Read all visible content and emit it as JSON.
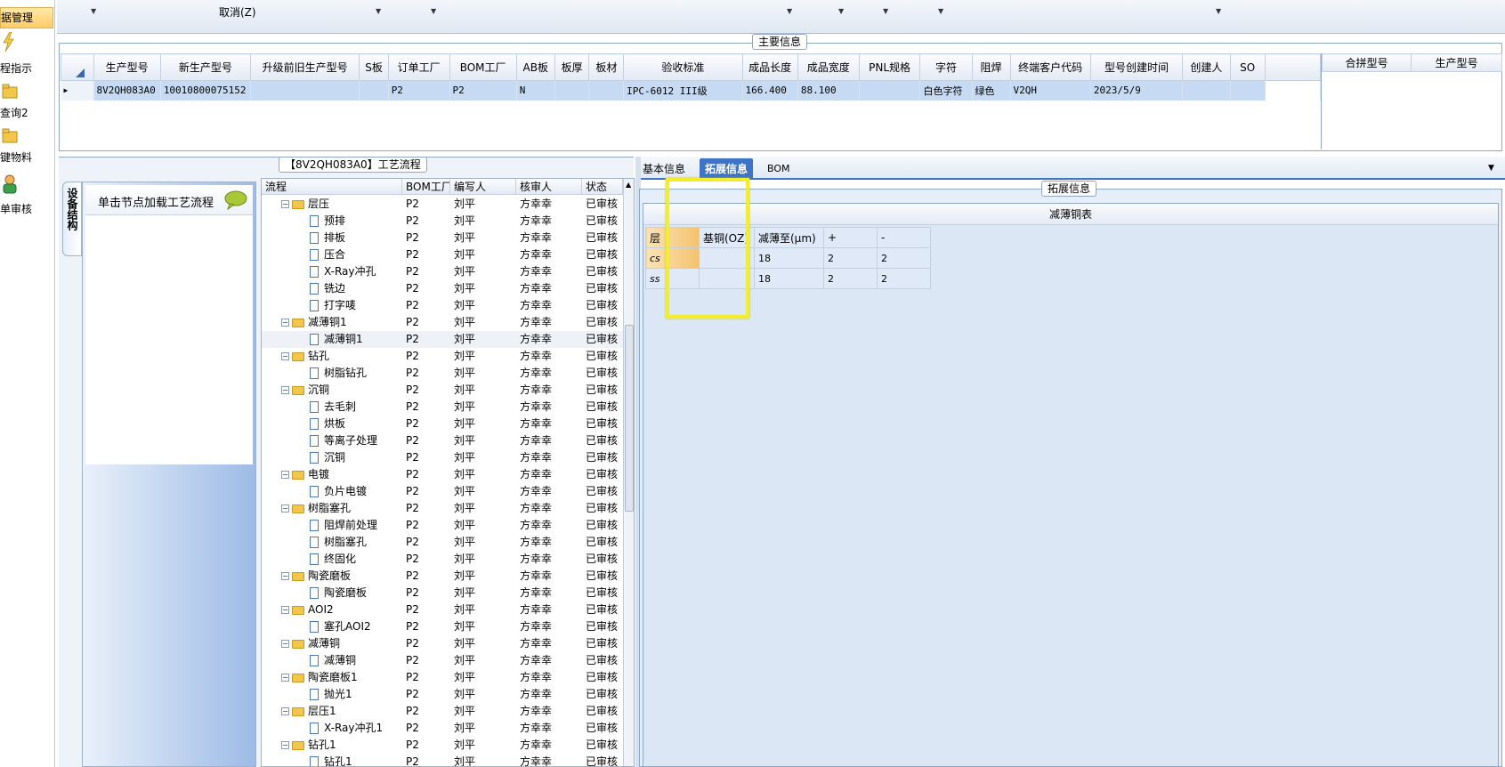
{
  "nav": {
    "items": [
      {
        "label": "据管理",
        "icon": "folder-icon"
      },
      {
        "label": "程指示",
        "icon": "lightning-icon"
      },
      {
        "label": "查询2",
        "icon": "folder-icon"
      },
      {
        "label": "键物料",
        "icon": "folder-icon"
      },
      {
        "label": "单审核",
        "icon": "user-icon"
      }
    ]
  },
  "toolbar": {
    "cancel_label": "取消(Z)"
  },
  "main_info": {
    "title": "主要信息",
    "columns": [
      "生产型号",
      "新生产型号",
      "升级前旧生产型号",
      "S板",
      "订单工厂",
      "BOM工厂",
      "AB板",
      "板厚",
      "板材",
      "验收标准",
      "成品长度",
      "成品宽度",
      "PNL规格",
      "字符",
      "阻焊",
      "终端客户代码",
      "型号创建时间",
      "创建人",
      "SO"
    ],
    "row": [
      "8V2QH083A0",
      "10010800075152",
      "",
      "",
      "P2",
      "P2",
      "N",
      "",
      "",
      "IPC-6012 III级",
      "166.400",
      "88.100",
      "",
      "白色字符",
      "绿色",
      "V2QH",
      "2023/5/9",
      "",
      ""
    ],
    "side_columns": [
      "合拼型号",
      "生产型号"
    ]
  },
  "process": {
    "title": "【8V2QH083A0】工艺流程",
    "side_tab": "设备结构",
    "load_hint": "单击节点加载工艺流程",
    "columns": [
      "流程",
      "BOM工厂",
      "编写人",
      "核审人",
      "状态"
    ],
    "rows": [
      {
        "name": "层压",
        "type": "folder",
        "bom": "P2",
        "writer": "刘平",
        "reviewer": "方幸幸",
        "status": "已审核"
      },
      {
        "name": "预排",
        "type": "doc",
        "bom": "P2",
        "writer": "刘平",
        "reviewer": "方幸幸",
        "status": "已审核"
      },
      {
        "name": "排板",
        "type": "doc",
        "bom": "P2",
        "writer": "刘平",
        "reviewer": "方幸幸",
        "status": "已审核"
      },
      {
        "name": "压合",
        "type": "doc",
        "bom": "P2",
        "writer": "刘平",
        "reviewer": "方幸幸",
        "status": "已审核"
      },
      {
        "name": "X-Ray冲孔",
        "type": "doc",
        "bom": "P2",
        "writer": "刘平",
        "reviewer": "方幸幸",
        "status": "已审核"
      },
      {
        "name": "铣边",
        "type": "doc",
        "bom": "P2",
        "writer": "刘平",
        "reviewer": "方幸幸",
        "status": "已审核"
      },
      {
        "name": "打字唛",
        "type": "doc",
        "bom": "P2",
        "writer": "刘平",
        "reviewer": "方幸幸",
        "status": "已审核"
      },
      {
        "name": "减薄铜1",
        "type": "folder",
        "bom": "P2",
        "writer": "刘平",
        "reviewer": "方幸幸",
        "status": "已审核"
      },
      {
        "name": "减薄铜1",
        "type": "doc",
        "bom": "P2",
        "writer": "刘平",
        "reviewer": "方幸幸",
        "status": "已审核"
      },
      {
        "name": "钻孔",
        "type": "folder",
        "bom": "P2",
        "writer": "刘平",
        "reviewer": "方幸幸",
        "status": "已审核"
      },
      {
        "name": "树脂钻孔",
        "type": "doc",
        "bom": "P2",
        "writer": "刘平",
        "reviewer": "方幸幸",
        "status": "已审核"
      },
      {
        "name": "沉铜",
        "type": "folder",
        "bom": "P2",
        "writer": "刘平",
        "reviewer": "方幸幸",
        "status": "已审核"
      },
      {
        "name": "去毛刺",
        "type": "doc",
        "bom": "P2",
        "writer": "刘平",
        "reviewer": "方幸幸",
        "status": "已审核"
      },
      {
        "name": "烘板",
        "type": "doc",
        "bom": "P2",
        "writer": "刘平",
        "reviewer": "方幸幸",
        "status": "已审核"
      },
      {
        "name": "等离子处理",
        "type": "doc",
        "bom": "P2",
        "writer": "刘平",
        "reviewer": "方幸幸",
        "status": "已审核"
      },
      {
        "name": "沉铜",
        "type": "doc",
        "bom": "P2",
        "writer": "刘平",
        "reviewer": "方幸幸",
        "status": "已审核"
      },
      {
        "name": "电镀",
        "type": "folder",
        "bom": "P2",
        "writer": "刘平",
        "reviewer": "方幸幸",
        "status": "已审核"
      },
      {
        "name": "负片电镀",
        "type": "doc",
        "bom": "P2",
        "writer": "刘平",
        "reviewer": "方幸幸",
        "status": "已审核"
      },
      {
        "name": "树脂塞孔",
        "type": "folder",
        "bom": "P2",
        "writer": "刘平",
        "reviewer": "方幸幸",
        "status": "已审核"
      },
      {
        "name": "阻焊前处理",
        "type": "doc",
        "bom": "P2",
        "writer": "刘平",
        "reviewer": "方幸幸",
        "status": "已审核"
      },
      {
        "name": "树脂塞孔",
        "type": "doc",
        "bom": "P2",
        "writer": "刘平",
        "reviewer": "方幸幸",
        "status": "已审核"
      },
      {
        "name": "终固化",
        "type": "doc",
        "bom": "P2",
        "writer": "刘平",
        "reviewer": "方幸幸",
        "status": "已审核"
      },
      {
        "name": "陶瓷磨板",
        "type": "folder",
        "bom": "P2",
        "writer": "刘平",
        "reviewer": "方幸幸",
        "status": "已审核"
      },
      {
        "name": "陶瓷磨板",
        "type": "doc",
        "bom": "P2",
        "writer": "刘平",
        "reviewer": "方幸幸",
        "status": "已审核"
      },
      {
        "name": "AOI2",
        "type": "folder",
        "bom": "P2",
        "writer": "刘平",
        "reviewer": "方幸幸",
        "status": "已审核"
      },
      {
        "name": "塞孔AOI2",
        "type": "doc",
        "bom": "P2",
        "writer": "刘平",
        "reviewer": "方幸幸",
        "status": "已审核"
      },
      {
        "name": "减薄铜",
        "type": "folder",
        "bom": "P2",
        "writer": "刘平",
        "reviewer": "方幸幸",
        "status": "已审核"
      },
      {
        "name": "减薄铜",
        "type": "doc",
        "bom": "P2",
        "writer": "刘平",
        "reviewer": "方幸幸",
        "status": "已审核"
      },
      {
        "name": "陶瓷磨板1",
        "type": "folder",
        "bom": "P2",
        "writer": "刘平",
        "reviewer": "方幸幸",
        "status": "已审核"
      },
      {
        "name": "抛光1",
        "type": "doc",
        "bom": "P2",
        "writer": "刘平",
        "reviewer": "方幸幸",
        "status": "已审核"
      },
      {
        "name": "层压1",
        "type": "folder",
        "bom": "P2",
        "writer": "刘平",
        "reviewer": "方幸幸",
        "status": "已审核"
      },
      {
        "name": "X-Ray冲孔1",
        "type": "doc",
        "bom": "P2",
        "writer": "刘平",
        "reviewer": "方幸幸",
        "status": "已审核"
      },
      {
        "name": "钻孔1",
        "type": "folder",
        "bom": "P2",
        "writer": "刘平",
        "reviewer": "方幸幸",
        "status": "已审核"
      },
      {
        "name": "钻孔1",
        "type": "doc",
        "bom": "P2",
        "writer": "刘平",
        "reviewer": "方幸幸",
        "status": "已审核"
      }
    ]
  },
  "tabs": {
    "basic": "基本信息",
    "extended": "拓展信息",
    "bom": "BOM"
  },
  "extended": {
    "title": "拓展信息",
    "table_title": "减薄铜表",
    "columns": [
      "层",
      "基铜(OZ)",
      "减薄至(μm)",
      "+",
      "-"
    ],
    "rows": [
      [
        "cs",
        "",
        "18",
        "2",
        "2"
      ],
      [
        "ss",
        "",
        "18",
        "2",
        "2"
      ]
    ]
  },
  "colors": {
    "accent": "#3d74c7",
    "selection": "#c7daf3",
    "highlight_box": "#f2ee2a",
    "orange_cell": "#f7c36e"
  }
}
